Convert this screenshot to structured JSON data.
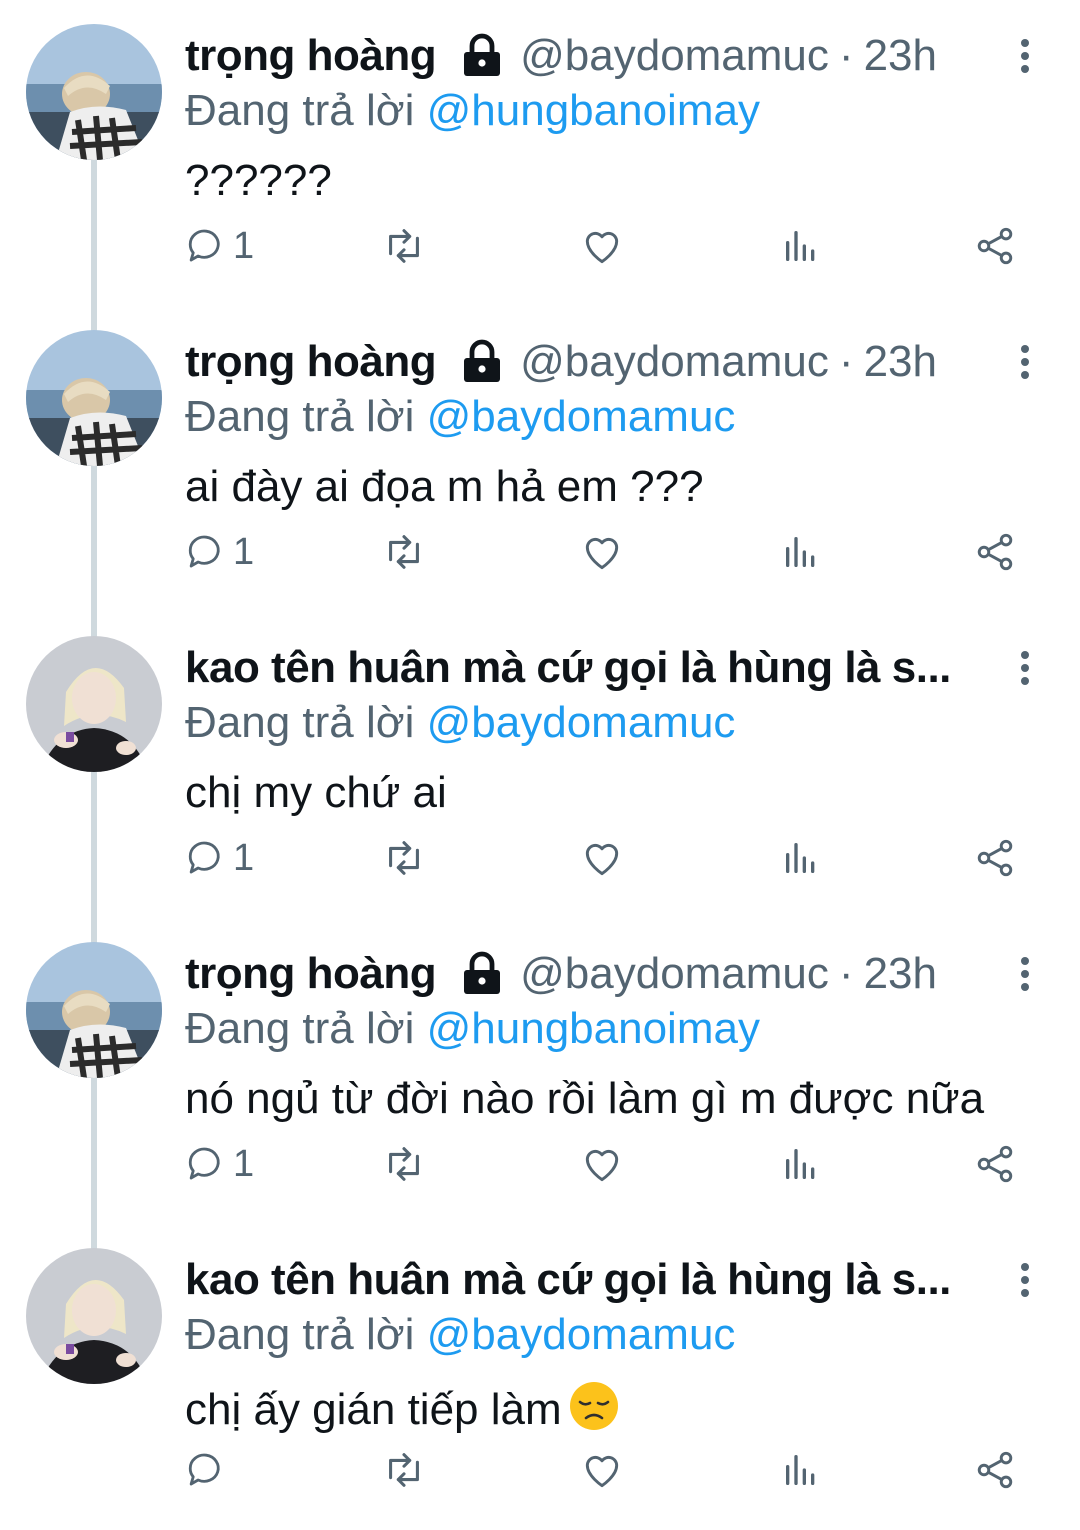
{
  "tweets": [
    {
      "name": "trọng hoàng",
      "locked": true,
      "handle": "@baydomamuc",
      "sep": "·",
      "time": "23h",
      "replying_prefix": "Đang trả lời ",
      "mention": "@hungbanoimay",
      "text": "??????",
      "reply_count": "1",
      "avatar": "user-1"
    },
    {
      "name": "trọng hoàng",
      "locked": true,
      "handle": "@baydomamuc",
      "sep": "·",
      "time": "23h",
      "replying_prefix": "Đang trả lời ",
      "mention": "@baydomamuc",
      "text": "ai đày ai đọa m hả em ???",
      "reply_count": "1",
      "avatar": "user-1"
    },
    {
      "name": "kao tên huân mà cứ gọi là hùng là s...",
      "locked": false,
      "handle": "",
      "sep": "",
      "time": "",
      "replying_prefix": "Đang trả lời ",
      "mention": "@baydomamuc",
      "text": "chị my chứ ai",
      "reply_count": "1",
      "avatar": "user-2"
    },
    {
      "name": "trọng hoàng",
      "locked": true,
      "handle": "@baydomamuc",
      "sep": "·",
      "time": "23h",
      "replying_prefix": "Đang trả lời ",
      "mention": "@hungbanoimay",
      "text": "nó ngủ từ đời nào rồi làm gì m được nữa",
      "reply_count": "1",
      "avatar": "user-1"
    },
    {
      "name": "kao tên huân mà cứ gọi là hùng là s...",
      "locked": false,
      "handle": "",
      "sep": "",
      "time": "",
      "replying_prefix": "Đang trả lời ",
      "mention": "@baydomamuc",
      "text": "chị ấy gián tiếp làm",
      "emoji": "disappointed-face-emoji",
      "reply_count": "",
      "avatar": "user-2"
    }
  ],
  "icons": {
    "reply": "reply-icon",
    "retweet": "retweet-icon",
    "like": "like-icon",
    "views": "views-icon",
    "share": "share-icon",
    "more": "more-vertical-icon",
    "lock": "lock-icon"
  },
  "colors": {
    "name": "#0f1419",
    "secondary": "#536471",
    "mention": "#1d9bf0",
    "thread_line": "#cfd9de"
  }
}
